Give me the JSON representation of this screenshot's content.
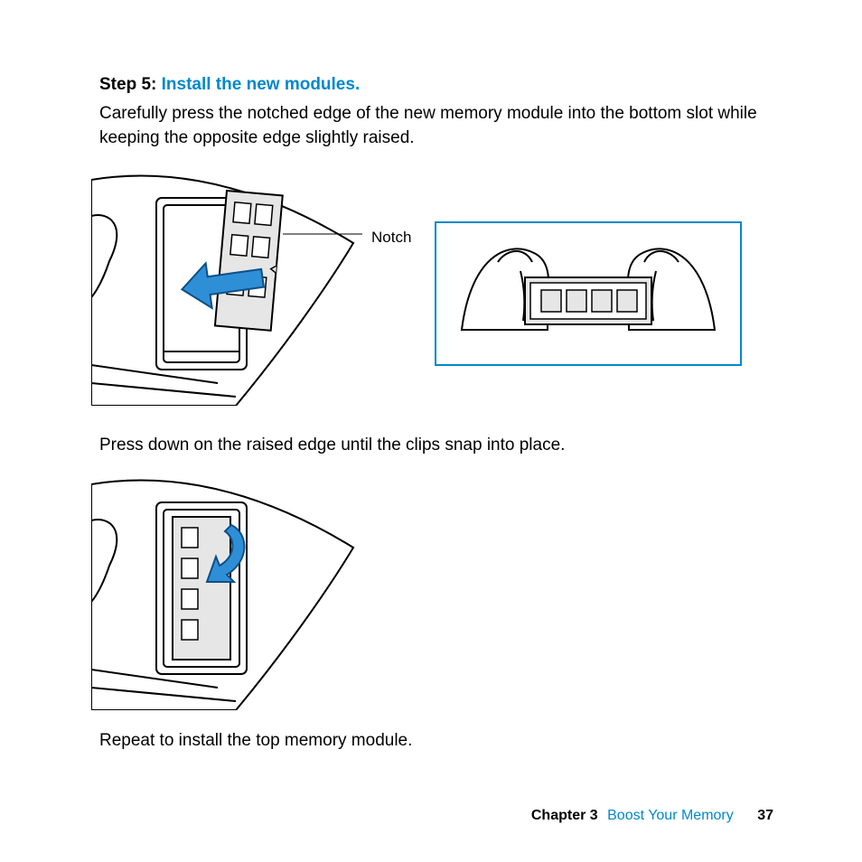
{
  "step": {
    "label": "Step 5:  ",
    "title": "Install the new modules."
  },
  "para1": "Carefully press the notched edge of the new memory module into the bottom slot while keeping the opposite edge slightly raised.",
  "callout": "Notch",
  "para2": "Press down on the raised edge until the clips snap into place.",
  "para3": "Repeat to install the top memory module.",
  "footer": {
    "chapter": "Chapter 3",
    "title": "Boost Your Memory",
    "page": "37"
  }
}
